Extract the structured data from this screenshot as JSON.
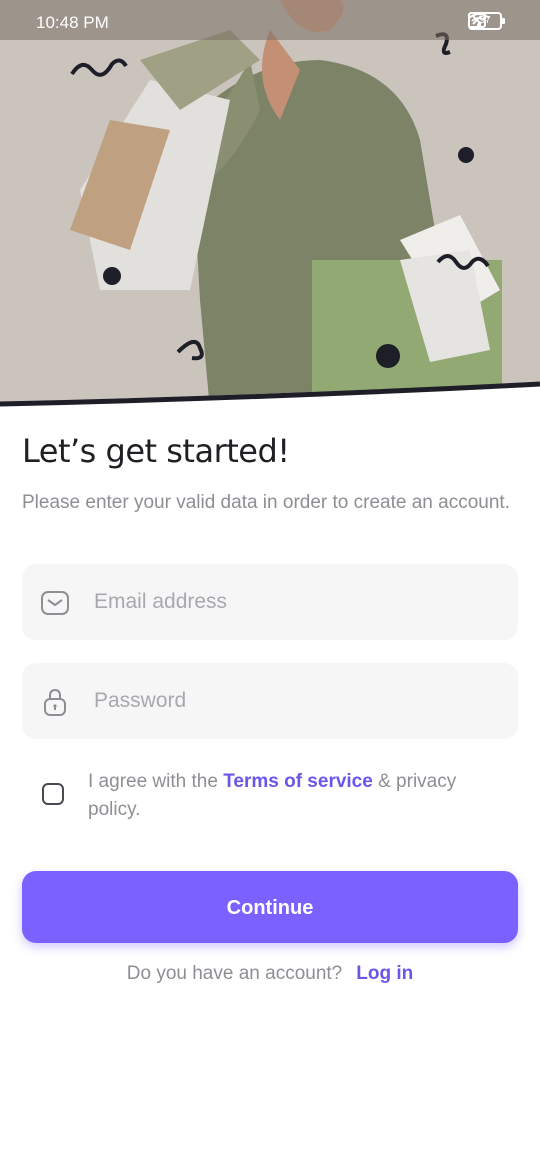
{
  "status_bar": {
    "time": "10:48 PM",
    "battery": "97"
  },
  "header": {
    "title": "Let’s get started!",
    "subtitle": "Please enter your valid data in order to create an account."
  },
  "form": {
    "email": {
      "placeholder": "Email address",
      "icon": "mail-icon"
    },
    "password": {
      "placeholder": "Password",
      "icon": "lock-icon"
    },
    "agree": {
      "prefix": "I agree with the ",
      "terms_link": "Terms of service",
      "suffix": " & privacy policy."
    },
    "continue_label": "Continue"
  },
  "footer": {
    "question": "Do you have an account?",
    "login_label": "Log in"
  },
  "colors": {
    "accent": "#7b61ff",
    "link": "#6a57e8"
  }
}
